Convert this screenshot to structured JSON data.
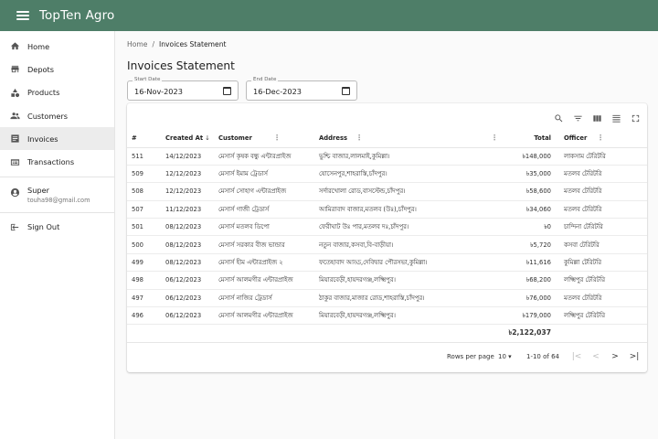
{
  "app": {
    "title": "TopTen Agro"
  },
  "sidebar": {
    "items": [
      {
        "label": "Home",
        "icon": "home-icon"
      },
      {
        "label": "Depots",
        "icon": "store-icon"
      },
      {
        "label": "Products",
        "icon": "category-icon"
      },
      {
        "label": "Customers",
        "icon": "people-icon"
      },
      {
        "label": "Invoices",
        "icon": "invoice-icon",
        "active": true
      },
      {
        "label": "Transactions",
        "icon": "receipt-icon"
      }
    ],
    "user": {
      "name": "Super",
      "email": "touha98@gmail.com"
    },
    "signout": "Sign Out"
  },
  "breadcrumb": {
    "home": "Home",
    "sep": "/",
    "current": "Invoices Statement"
  },
  "page": {
    "title": "Invoices Statement"
  },
  "filters": {
    "start": {
      "label": "Start Date",
      "value": "16-Nov-2023"
    },
    "end": {
      "label": "End Date",
      "value": "16-Dec-2023"
    }
  },
  "table": {
    "headers": {
      "num": "#",
      "created": "Created At",
      "customer": "Customer",
      "address": "Address",
      "total": "Total",
      "officer": "Officer"
    },
    "sort_arrow": "↓",
    "rows": [
      {
        "num": "511",
        "created": "14/12/2023",
        "customer": "মেসার্স কৃষক বন্ধু এন্টারপ্রাইজ",
        "address": "ভুশ্চি বাজার,লালমাই,কুমিল্লা।",
        "total": "৳148,000",
        "officer": "লাকসাম টেরিটরি"
      },
      {
        "num": "509",
        "created": "12/12/2023",
        "customer": "মেসার্স ইমাম ট্রেডার্স",
        "address": "যোসেনপুর,শাহরাস্তি,চাঁদপুর।",
        "total": "৳35,000",
        "officer": "মতলব টেরিটরি"
      },
      {
        "num": "508",
        "created": "12/12/2023",
        "customer": "মেসার্স সোহাগ এন্টারপ্রাইজ",
        "address": "সর্দারখোলা রোড,বাসস্টেন্ড,চাঁদপুর।",
        "total": "৳58,600",
        "officer": "মতলব টেরিটরি"
      },
      {
        "num": "507",
        "created": "11/12/2023",
        "customer": "মেসার্স গাজী ট্রেডার্স",
        "address": "আমিরাবাদ বাজার,মতলব (উঃ),চাঁদপুর।",
        "total": "৳34,060",
        "officer": "মতলব টেরিটরি"
      },
      {
        "num": "501",
        "created": "08/12/2023",
        "customer": "মেসার্স মতলব ডিপো",
        "address": "ফেরীঘাট উঃ পার,মতলব দঃ,চাঁদপুর।",
        "total": "৳0",
        "officer": "চান্দিনা টেরিটরি"
      },
      {
        "num": "500",
        "created": "08/12/2023",
        "customer": "মেসার্স সরকার বীজ ভান্ডার",
        "address": "নতুন বাজার,কসবা,বি-বাড়ীয়া।",
        "total": "৳5,720",
        "officer": "কসবা টেরিটরি"
      },
      {
        "num": "499",
        "created": "08/12/2023",
        "customer": "মেসার্স হীম এন্টারপ্রাইজ ২",
        "address": "ফতেহাবাদ আড্ড,দেবিদ্বার পৌরসভা,কুমিল্লা।",
        "total": "৳11,616",
        "officer": "কুমিল্লা টেরিটরি"
      },
      {
        "num": "498",
        "created": "06/12/2023",
        "customer": "মেসার্স আলমগীর এন্টারপ্রাইজ",
        "address": "মিয়ারবেড়ী,হায়দরগঞ্জ,লক্ষ্মিপুর।",
        "total": "৳68,200",
        "officer": "লক্ষ্মিপুর টেরিটরি"
      },
      {
        "num": "497",
        "created": "06/12/2023",
        "customer": "মেসার্স নাজির ট্রেডার্স",
        "address": "ঠাকুর বাজার,মাজার রোড,শাহরাস্তি,চাঁদপুর।",
        "total": "৳76,000",
        "officer": "মতলব টেরিটরি"
      },
      {
        "num": "496",
        "created": "06/12/2023",
        "customer": "মেসার্স আলমগীর এন্টারপ্রাইজ",
        "address": "মিয়ারবেড়ী,হায়দরগঞ্জ,লক্ষ্মিপুর।",
        "total": "৳179,000",
        "officer": "লক্ষ্মিপুর টেরিটরি"
      }
    ],
    "grand_total": "৳2,122,037"
  },
  "pagination": {
    "rows_label": "Rows per page",
    "rows_value": "10",
    "range": "1-10 of 64"
  }
}
